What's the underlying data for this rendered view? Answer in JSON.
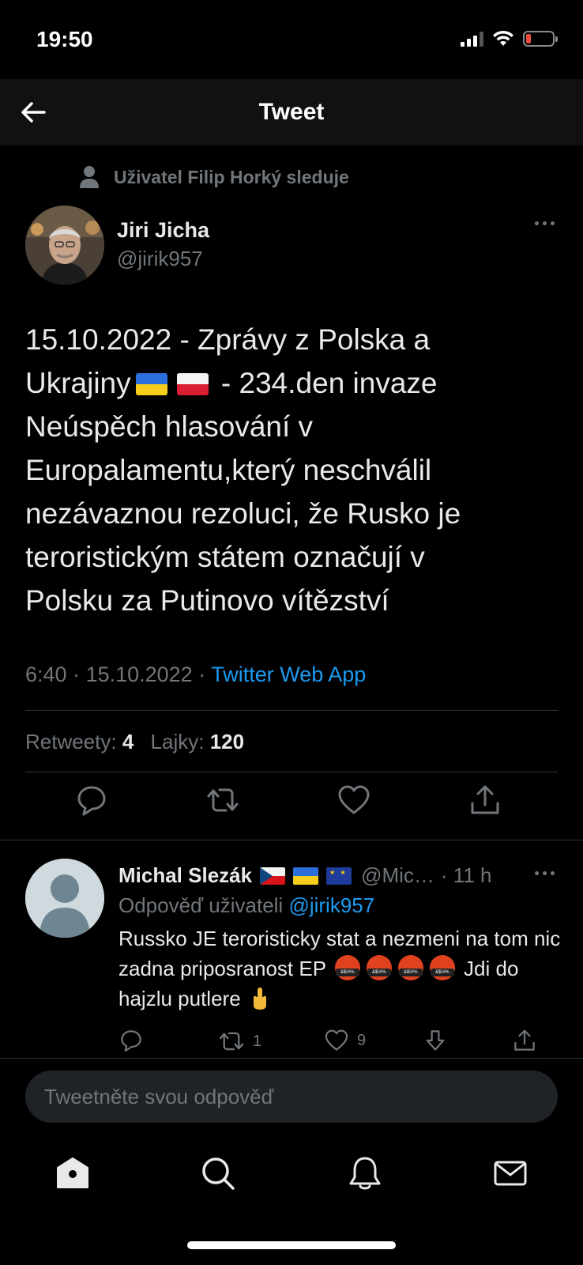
{
  "status_bar": {
    "time": "19:50"
  },
  "header": {
    "title": "Tweet"
  },
  "social_context": "Uživatel Filip Horký sleduje",
  "tweet": {
    "author_name": "Jiri Jicha",
    "author_handle": "@jirik957",
    "text_line1": "15.10.2022 - Zprávy z Polska a",
    "text_line2_a": "Ukrajiny",
    "text_line2_b": " - 234.den invaze",
    "text_line3": "Neúspěch hlasování v",
    "text_line4": "Europalamentu,který neschválil",
    "text_line5": "nezávaznou rezoluci, že Rusko je",
    "text_line6": "teroristickým státem označují v",
    "text_line7": "Polsku za Putinovo vítězství",
    "time": "6:40",
    "date": "15.10.2022",
    "source": "Twitter Web App",
    "retweets_label": "Retweety:",
    "retweets_count": "4",
    "likes_label": "Lajky:",
    "likes_count": "120"
  },
  "reply": {
    "author_name": "Michal Slezák",
    "author_handle": "@Mic…",
    "age": "· 11 h",
    "replying_to_label": "Odpověď uživateli",
    "replying_to_handle": "@jirik957",
    "text_a": "Russko JE teroristicky stat a nezmeni na tom nic zadna priposranost EP",
    "text_b": "Jdi do hajzlu putlere",
    "retweet_count": "1",
    "like_count": "9"
  },
  "composer": {
    "placeholder": "Tweetněte svou odpověď"
  },
  "icons": {
    "back": "arrow-left-icon",
    "reply": "speech-bubble-icon",
    "retweet": "retweet-icon",
    "like": "heart-icon",
    "share": "share-icon",
    "home": "home-icon",
    "search": "search-icon",
    "notifications": "bell-icon",
    "messages": "mail-icon"
  },
  "colors": {
    "background": "#000000",
    "text": "#e7e9ea",
    "muted": "#71767b",
    "accent": "#1d9bf0",
    "divider": "#2f3336"
  }
}
